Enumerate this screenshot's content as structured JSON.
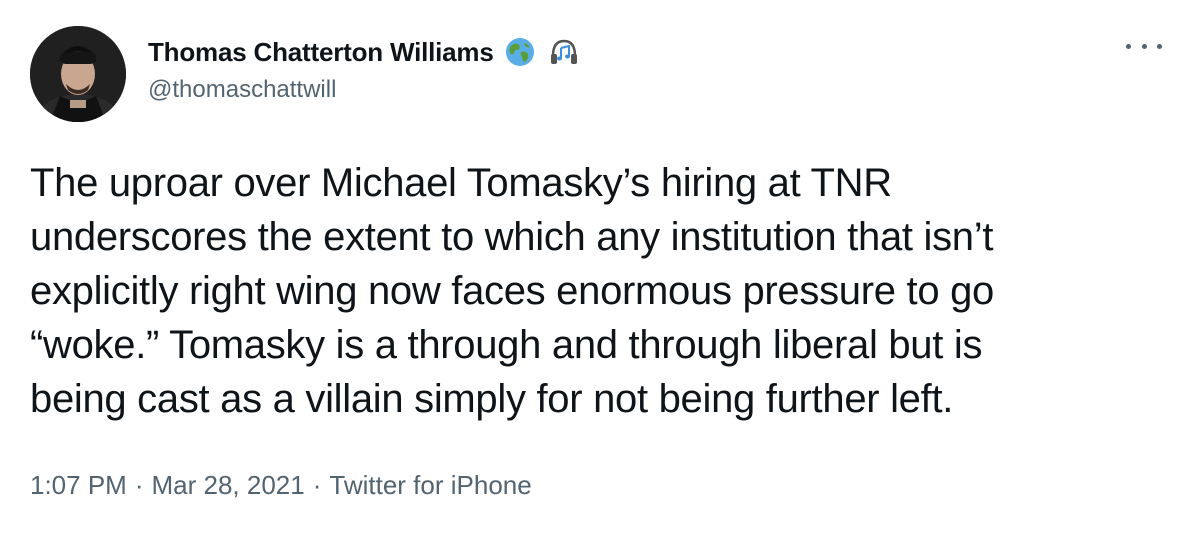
{
  "author": {
    "display_name": "Thomas Chatterton Williams",
    "handle": "@thomaschattwill",
    "badges": [
      {
        "icon": "globe-icon"
      },
      {
        "icon": "headphones-music-icon"
      }
    ]
  },
  "tweet": {
    "text": "The uproar over Michael Tomasky’s hiring at TNR\nunderscores the extent to which any institution that isn’t\nexplicitly right wing now faces enormous pressure to go\n“woke.” Tomasky is a through and through liberal but is\nbeing cast as a villain simply for not being further left.",
    "time": "1:07 PM",
    "date": "Mar 28, 2021",
    "source": "Twitter for iPhone",
    "separator": "·"
  },
  "menu": {
    "icon": "more-options-icon"
  },
  "colors": {
    "text_primary": "#0f1419",
    "text_secondary": "#536471",
    "background": "#ffffff"
  }
}
